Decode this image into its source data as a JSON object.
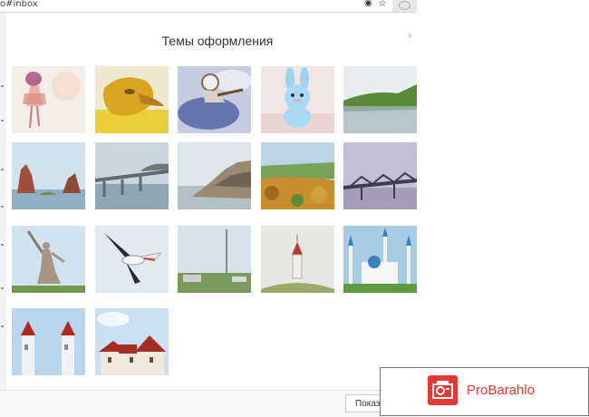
{
  "browser": {
    "url_fragment": "o#inbox",
    "eye_icon": "eye-icon",
    "star_icon": "star-icon"
  },
  "dialog": {
    "title": "Темы оформления",
    "close_icon": "close-icon",
    "themes": [
      {
        "name": "girl-illustration"
      },
      {
        "name": "golden-face"
      },
      {
        "name": "astronaut-watercolor"
      },
      {
        "name": "plush-bunny"
      },
      {
        "name": "river-shore"
      },
      {
        "name": "rock-formation"
      },
      {
        "name": "river-bridge"
      },
      {
        "name": "rocky-cape"
      },
      {
        "name": "autumn-valley"
      },
      {
        "name": "railway-bridge"
      },
      {
        "name": "motherland-statue"
      },
      {
        "name": "flying-stork"
      },
      {
        "name": "tv-tower"
      },
      {
        "name": "chapel-on-hill"
      },
      {
        "name": "mosque"
      },
      {
        "name": "red-spire-towers"
      },
      {
        "name": "red-roof-palace"
      }
    ],
    "show_button_label": "Показа"
  },
  "watermark": {
    "text": "ProBarahlo"
  }
}
